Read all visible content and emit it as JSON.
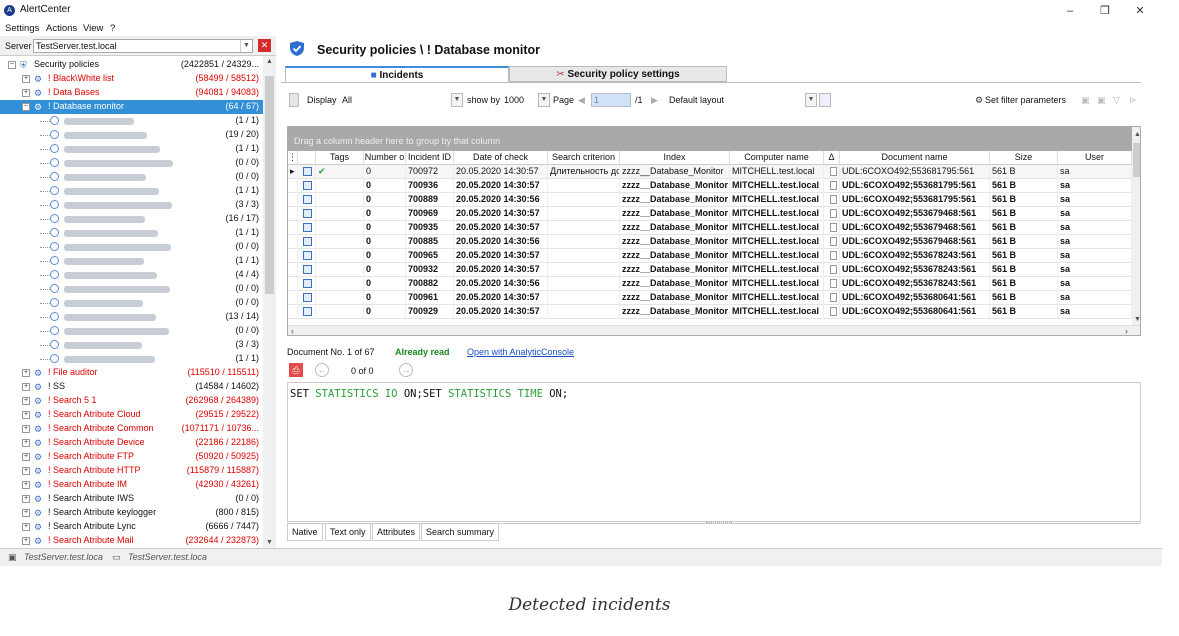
{
  "window": {
    "title": "AlertCenter",
    "minimize": "–",
    "maximize": "❐",
    "close": "✕"
  },
  "menu": [
    "Settings",
    "Actions",
    "View",
    "?"
  ],
  "server": {
    "label": "Server",
    "value": "TestServer.test.local"
  },
  "tree": {
    "root": {
      "label": "Security policies",
      "count": "(2422851 / 24329..."
    },
    "items": [
      {
        "label": "! Black\\White list",
        "count": "(58499 / 58512)",
        "red": true
      },
      {
        "label": "! Data Bases",
        "count": "(94081 / 94083)",
        "red": true
      },
      {
        "label": "! Database monitor",
        "count": "(64 / 67)",
        "red": true,
        "selected": true
      }
    ],
    "children_counts": [
      "(1 / 1)",
      "(19 / 20)",
      "(1 / 1)",
      "(0 / 0)",
      "(0 / 0)",
      "(1 / 1)",
      "(3 / 3)",
      "(16 / 17)",
      "(1 / 1)",
      "(0 / 0)",
      "(1 / 1)",
      "(4 / 4)",
      "(0 / 0)",
      "(0 / 0)",
      "(13 / 14)",
      "(0 / 0)",
      "(3 / 3)",
      "(1 / 1)"
    ],
    "items2": [
      {
        "label": "! File auditor",
        "count": "(115510 / 115511)",
        "red": true
      },
      {
        "label": "! SS",
        "count": "(14584 / 14602)",
        "red": false
      },
      {
        "label": "! Search 5 1",
        "count": "(262968 / 264389)",
        "red": true
      },
      {
        "label": "! Search Atribute Cloud",
        "count": "(29515 / 29522)",
        "red": true
      },
      {
        "label": "! Search Atribute Common",
        "count": "(1071171 / 10736...",
        "red": true
      },
      {
        "label": "! Search Atribute Device",
        "count": "(22186 / 22186)",
        "red": true
      },
      {
        "label": "! Search Atribute FTP",
        "count": "(50920 / 50925)",
        "red": true
      },
      {
        "label": "! Search Atribute HTTP",
        "count": "(115879 / 115887)",
        "red": true
      },
      {
        "label": "! Search Atribute IM",
        "count": "(42930 / 43261)",
        "red": true
      },
      {
        "label": "! Search Atribute IWS",
        "count": "(0 / 0)",
        "red": false
      },
      {
        "label": "! Search Atribute keylogger",
        "count": "(800 / 815)",
        "red": false
      },
      {
        "label": "! Search Atribute Lync",
        "count": "(6666 / 7447)",
        "red": false
      },
      {
        "label": "! Search Atribute Mail",
        "count": "(232644 / 232873)",
        "red": true
      }
    ]
  },
  "status": {
    "left": "TestServer.test.loca",
    "right": "TestServer.test.loca"
  },
  "header": {
    "title": "Security policies \\ ! Database monitor"
  },
  "tabs": {
    "incidents": "Incidents",
    "settings": "Security policy settings"
  },
  "toolbar": {
    "display_label": "Display",
    "display_value": "All",
    "show_by_label": "show by",
    "show_by_value": "1000",
    "page_label": "Page",
    "page_value": "1",
    "page_total": "/1",
    "layout_value": "Default layout",
    "filter_label": "Set filter parameters"
  },
  "grid": {
    "group_hint": "Drag a column header here to group by that column",
    "columns": [
      "Tags",
      "Number o",
      "Incident ID",
      "Date of check",
      "Search criterion",
      "Index",
      "Computer name",
      "Δ",
      "Document name",
      "Size",
      "User"
    ],
    "rows": [
      {
        "num": "0",
        "id": "700972",
        "date": "20.05.2020 14:30:57",
        "crit": "Длительность до",
        "index": "zzzz__Database_Monitor",
        "comp": "MITCHELL.test.local",
        "doc": "UDL:6COXO492;553681795:561",
        "size": "561 B",
        "user": "sa"
      },
      {
        "num": "0",
        "id": "700936",
        "date": "20.05.2020 14:30:57",
        "crit": "",
        "index": "zzzz__Database_Monitor",
        "comp": "MITCHELL.test.local",
        "doc": "UDL:6COXO492;553681795:561",
        "size": "561 B",
        "user": "sa"
      },
      {
        "num": "0",
        "id": "700889",
        "date": "20.05.2020 14:30:56",
        "crit": "",
        "index": "zzzz__Database_Monitor",
        "comp": "MITCHELL.test.local",
        "doc": "UDL:6COXO492;553681795:561",
        "size": "561 B",
        "user": "sa"
      },
      {
        "num": "0",
        "id": "700969",
        "date": "20.05.2020 14:30:57",
        "crit": "",
        "index": "zzzz__Database_Monitor",
        "comp": "MITCHELL.test.local",
        "doc": "UDL:6COXO492;553679468:561",
        "size": "561 B",
        "user": "sa"
      },
      {
        "num": "0",
        "id": "700935",
        "date": "20.05.2020 14:30:57",
        "crit": "",
        "index": "zzzz__Database_Monitor",
        "comp": "MITCHELL.test.local",
        "doc": "UDL:6COXO492;553679468:561",
        "size": "561 B",
        "user": "sa"
      },
      {
        "num": "0",
        "id": "700885",
        "date": "20.05.2020 14:30:56",
        "crit": "",
        "index": "zzzz__Database_Monitor",
        "comp": "MITCHELL.test.local",
        "doc": "UDL:6COXO492;553679468:561",
        "size": "561 B",
        "user": "sa"
      },
      {
        "num": "0",
        "id": "700965",
        "date": "20.05.2020 14:30:57",
        "crit": "",
        "index": "zzzz__Database_Monitor",
        "comp": "MITCHELL.test.local",
        "doc": "UDL:6COXO492;553678243:561",
        "size": "561 B",
        "user": "sa"
      },
      {
        "num": "0",
        "id": "700932",
        "date": "20.05.2020 14:30:57",
        "crit": "",
        "index": "zzzz__Database_Monitor",
        "comp": "MITCHELL.test.local",
        "doc": "UDL:6COXO492;553678243:561",
        "size": "561 B",
        "user": "sa"
      },
      {
        "num": "0",
        "id": "700882",
        "date": "20.05.2020 14:30:56",
        "crit": "",
        "index": "zzzz__Database_Monitor",
        "comp": "MITCHELL.test.local",
        "doc": "UDL:6COXO492;553678243:561",
        "size": "561 B",
        "user": "sa"
      },
      {
        "num": "0",
        "id": "700961",
        "date": "20.05.2020 14:30:57",
        "crit": "",
        "index": "zzzz__Database_Monitor",
        "comp": "MITCHELL.test.local",
        "doc": "UDL:6COXO492;553680641:561",
        "size": "561 B",
        "user": "sa"
      },
      {
        "num": "0",
        "id": "700929",
        "date": "20.05.2020 14:30:57",
        "crit": "",
        "index": "zzzz__Database_Monitor",
        "comp": "MITCHELL.test.local",
        "doc": "UDL:6COXO492;553680641:561",
        "size": "561 B",
        "user": "sa"
      }
    ]
  },
  "docinfo": {
    "number": "Document No. 1 of 67",
    "status": "Already read",
    "open_link": "Open with AnalyticConsole"
  },
  "docnav": {
    "counter": "0 of 0"
  },
  "sql": {
    "kw1": "SET",
    "opt1": "STATISTICS IO",
    "val1": "ON;SET",
    "opt2": "STATISTICS TIME",
    "val2": "ON;"
  },
  "bottom_tabs": [
    "Native",
    "Text only",
    "Attributes",
    "Search summary"
  ],
  "caption": "Detected incidents"
}
